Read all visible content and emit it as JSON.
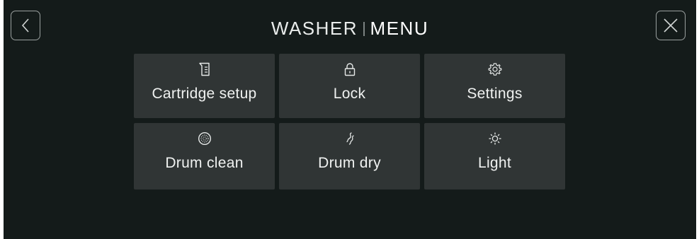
{
  "header": {
    "title_left": "WASHER",
    "title_right": "MENU",
    "back_icon": "chevron-left-icon",
    "close_icon": "close-icon"
  },
  "menu": {
    "items": [
      {
        "label": "Cartridge setup",
        "icon": "cartridge-icon"
      },
      {
        "label": "Lock",
        "icon": "lock-icon"
      },
      {
        "label": "Settings",
        "icon": "gear-icon"
      },
      {
        "label": "Drum clean",
        "icon": "drum-clean-icon"
      },
      {
        "label": "Drum dry",
        "icon": "drum-dry-icon"
      },
      {
        "label": "Light",
        "icon": "light-icon"
      }
    ]
  },
  "colors": {
    "background": "#141b1a",
    "tile": "#303535",
    "text": "#f0f2f1"
  }
}
